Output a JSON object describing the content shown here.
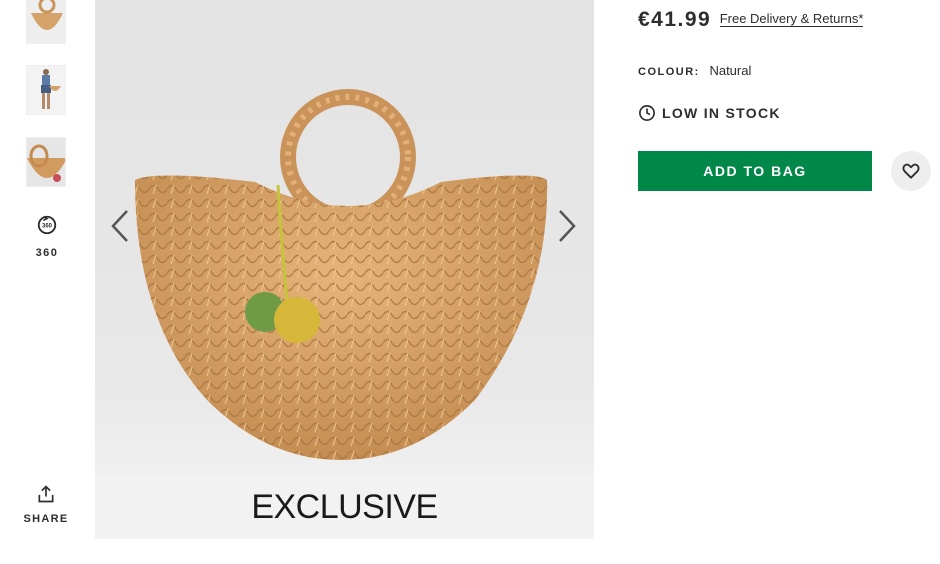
{
  "gallery": {
    "thumbnails": [
      {
        "alt": "bag-front"
      },
      {
        "alt": "model-view"
      },
      {
        "alt": "bag-inside"
      }
    ],
    "view_360_label": "360",
    "share_label": "SHARE",
    "banner_text": "EXCLUSIVE",
    "icons": {
      "prev": "chevron-left-icon",
      "next": "chevron-right-icon",
      "spin": "360-icon",
      "share": "share-icon"
    }
  },
  "product": {
    "price": "€41.99",
    "delivery_link": "Free Delivery & Returns*",
    "colour_label": "COLOUR:",
    "colour_value": "Natural",
    "stock_status": "LOW IN STOCK",
    "add_to_bag": "ADD TO BAG"
  },
  "colors": {
    "add_to_bag_bg": "#018849",
    "text": "#2d2d2d",
    "wishlist_bg": "#eeeeee"
  }
}
